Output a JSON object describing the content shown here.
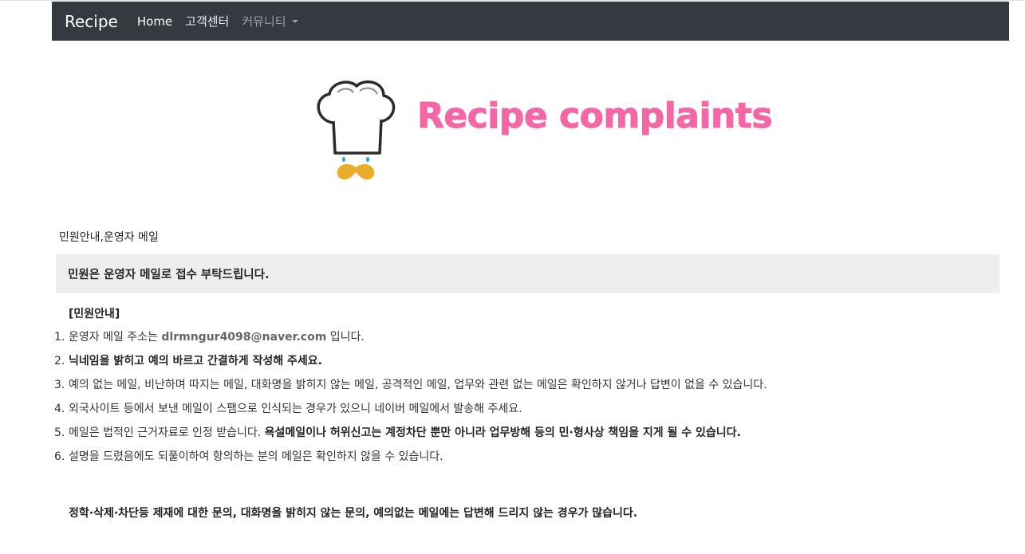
{
  "navbar": {
    "brand": "Recipe",
    "links": [
      "Home",
      "고객센터"
    ],
    "dropdown_label": "커뮤니티"
  },
  "logo": {
    "text": "Recipe complaints",
    "text_color": "#f467a6",
    "icon": "chef-hat-mustache-icon"
  },
  "section_label": "민원안내,운영자 메일",
  "notice": "민원은 운영자 메일로 접수 부탁드립니다.",
  "info_title": "[민원안내]",
  "rules": [
    {
      "num": "1.",
      "before": "운영자 메일 주소는 ",
      "email": "dlrmngur4098@naver.com",
      "after": " 입니다."
    },
    {
      "num": "2.",
      "bold": "닉네임을 밝히고 예의 바르고 간결하게 작성해 주세요."
    },
    {
      "num": "3.",
      "text": "예의 없는 메일, 비난하며 따지는 메일, 대화명을 밝히지 않는 메일, 공격적인 메일, 업무와 관련 없는 메일은 확인하지 않거나 답변이 없을 수 있습니다."
    },
    {
      "num": "4.",
      "text": "외국사이트 등에서 보낸 메일이 스팸으로 인식되는 경우가 있으니 네이버 메일에서 발송해 주세요."
    },
    {
      "num": "5.",
      "text": "메일은 법적인 근거자료로 인정 받습니다. ",
      "bold": "욕설메일이나 허위신고는 계정차단 뿐만 아니라 업무방해 등의 민·형사상 책임을 지게 될 수 있습니다."
    },
    {
      "num": "6.",
      "text": "설명을 드렸음에도 되풀이하여 항의하는 분의 메일은 확인하지 않을 수 있습니다."
    }
  ],
  "footer_note": "정학·삭제·차단등 제재에 대한 문의, 대화명을 밝히지 않는 문의, 예의없는 메일에는 답변해 드리지 않는 경우가 많습니다.",
  "colors": {
    "navbar_bg": "#343a40",
    "notice_bg": "#eeeeee",
    "accent_pink": "#f467a6"
  }
}
